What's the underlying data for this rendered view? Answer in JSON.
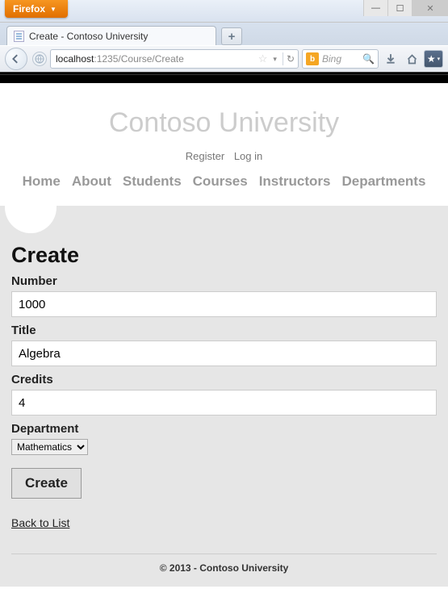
{
  "window": {
    "app_button": "Firefox",
    "tab_title": "Create - Contoso University",
    "url_host": "localhost",
    "url_port_path": ":1235/Course/Create",
    "search_placeholder": "Bing"
  },
  "site": {
    "title": "Contoso University",
    "account": {
      "register": "Register",
      "login": "Log in"
    },
    "nav": [
      "Home",
      "About",
      "Students",
      "Courses",
      "Instructors",
      "Departments"
    ]
  },
  "form": {
    "heading": "Create",
    "number_label": "Number",
    "number_value": "1000",
    "title_label": "Title",
    "title_value": "Algebra",
    "credits_label": "Credits",
    "credits_value": "4",
    "department_label": "Department",
    "department_selected": "Mathematics",
    "submit_label": "Create",
    "back_link": "Back to List"
  },
  "footer": "© 2013 - Contoso University"
}
